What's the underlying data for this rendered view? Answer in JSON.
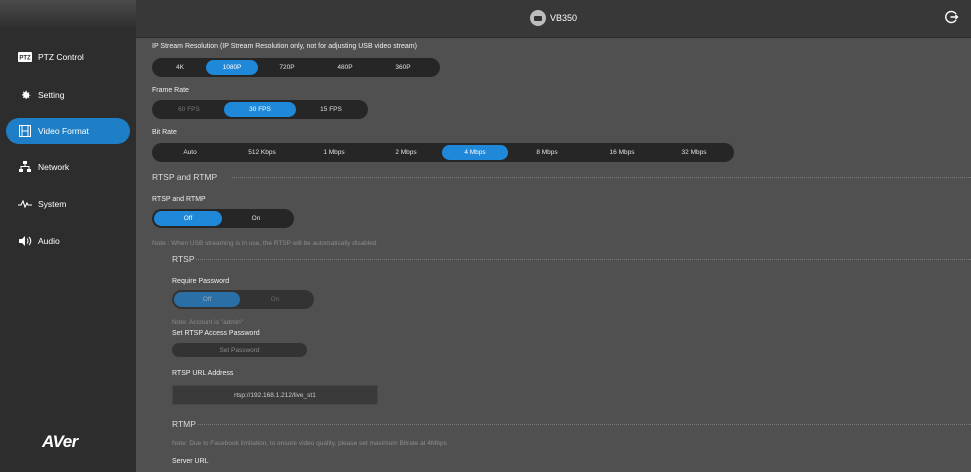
{
  "sidebar": {
    "items": [
      {
        "label": "PTZ Control",
        "icon": "ptz-icon"
      },
      {
        "label": "Setting",
        "icon": "gear-icon"
      },
      {
        "label": "Video Format",
        "icon": "video-format-icon"
      },
      {
        "label": "Network",
        "icon": "network-icon"
      },
      {
        "label": "System",
        "icon": "pulse-icon"
      },
      {
        "label": "Audio",
        "icon": "speaker-icon"
      }
    ],
    "active_index": 2,
    "logo": "AVer"
  },
  "header": {
    "device_name": "VB350",
    "logout_icon": "logout-icon"
  },
  "resolution": {
    "label": "IP Stream Resolution (IP Stream Resolution only, not for adjusting USB video stream)",
    "options": [
      "4K",
      "1080P",
      "720P",
      "480P",
      "360P"
    ],
    "selected": "1080P"
  },
  "frame_rate": {
    "label": "Frame Rate",
    "options": [
      "60 FPS",
      "30 FPS",
      "15 FPS"
    ],
    "selected": "30 FPS",
    "disabled": [
      "60 FPS"
    ]
  },
  "bit_rate": {
    "label": "Bit Rate",
    "options": [
      "Auto",
      "512 Kbps",
      "1 Mbps",
      "2 Mbps",
      "4 Mbps",
      "8 Mbps",
      "16 Mbps",
      "32 Mbps"
    ],
    "selected": "4 Mbps"
  },
  "rtsp_rtmp": {
    "section_title": "RTSP and RTMP",
    "toggle_label": "RTSP and RTMP",
    "options": [
      "Off",
      "On"
    ],
    "selected": "Off",
    "note": "Note : When USB streaming is in use, the RTSP will be automatically disabled"
  },
  "rtsp": {
    "section_title": "RTSP",
    "require_password_label": "Require Password",
    "options": [
      "Off",
      "On"
    ],
    "selected": "Off",
    "account_note": "Note: Account is \"admin\"",
    "set_password_label": "Set RTSP Access Password",
    "set_password_button": "Set Password",
    "url_label": "RTSP URL Address",
    "url_value": "rtsp://192.168.1.212/live_st1"
  },
  "rtmp": {
    "section_title": "RTMP",
    "note": "Note: Due to Facebook limitation, to ensure video quality, please set maximum Bitrate at 4Mbps",
    "server_url_label": "Server URL"
  },
  "colors": {
    "accent": "#1f88d8",
    "sidebar_active": "#1f7fc6",
    "background": "#505050"
  }
}
